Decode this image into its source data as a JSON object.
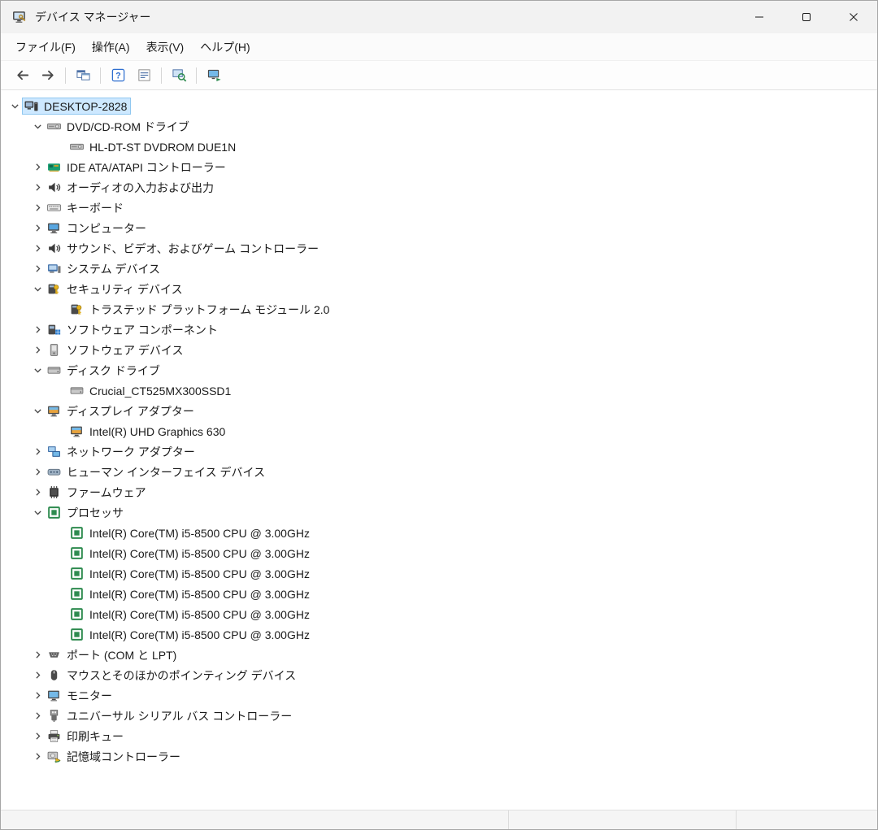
{
  "window": {
    "title": "デバイス マネージャー"
  },
  "menu": {
    "items": [
      {
        "label": "ファイル(F)"
      },
      {
        "label": "操作(A)"
      },
      {
        "label": "表示(V)"
      },
      {
        "label": "ヘルプ(H)"
      }
    ]
  },
  "toolbar": {
    "buttons": [
      "back",
      "forward",
      "show-console-tree",
      "help",
      "properties",
      "scan-hardware-changes",
      "update-driver"
    ]
  },
  "tree": {
    "items": [
      {
        "label": "DESKTOP-2828",
        "level": 0,
        "state": "expanded",
        "icon": "computer",
        "selected": true
      },
      {
        "label": "DVD/CD-ROM ドライブ",
        "level": 1,
        "state": "expanded",
        "icon": "dvd",
        "selected": false
      },
      {
        "label": "HL-DT-ST DVDROM DUE1N",
        "level": 2,
        "state": "leaf",
        "icon": "dvd",
        "selected": false
      },
      {
        "label": "IDE ATA/ATAPI コントローラー",
        "level": 1,
        "state": "collapsed",
        "icon": "ide",
        "selected": false
      },
      {
        "label": "オーディオの入力および出力",
        "level": 1,
        "state": "collapsed",
        "icon": "audio",
        "selected": false
      },
      {
        "label": "キーボード",
        "level": 1,
        "state": "collapsed",
        "icon": "keyboard",
        "selected": false
      },
      {
        "label": "コンピューター",
        "level": 1,
        "state": "collapsed",
        "icon": "computer2",
        "selected": false
      },
      {
        "label": "サウンド、ビデオ、およびゲーム コントローラー",
        "level": 1,
        "state": "collapsed",
        "icon": "sound",
        "selected": false
      },
      {
        "label": "システム デバイス",
        "level": 1,
        "state": "collapsed",
        "icon": "system",
        "selected": false
      },
      {
        "label": "セキュリティ デバイス",
        "level": 1,
        "state": "expanded",
        "icon": "security",
        "selected": false
      },
      {
        "label": "トラステッド プラットフォーム モジュール 2.0",
        "level": 2,
        "state": "leaf",
        "icon": "security",
        "selected": false
      },
      {
        "label": "ソフトウェア コンポーネント",
        "level": 1,
        "state": "collapsed",
        "icon": "software-component",
        "selected": false
      },
      {
        "label": "ソフトウェア デバイス",
        "level": 1,
        "state": "collapsed",
        "icon": "software-device",
        "selected": false
      },
      {
        "label": "ディスク ドライブ",
        "level": 1,
        "state": "expanded",
        "icon": "disk",
        "selected": false
      },
      {
        "label": "Crucial_CT525MX300SSD1",
        "level": 2,
        "state": "leaf",
        "icon": "disk",
        "selected": false
      },
      {
        "label": "ディスプレイ アダプター",
        "level": 1,
        "state": "expanded",
        "icon": "display",
        "selected": false
      },
      {
        "label": "Intel(R) UHD Graphics 630",
        "level": 2,
        "state": "leaf",
        "icon": "display",
        "selected": false
      },
      {
        "label": "ネットワーク アダプター",
        "level": 1,
        "state": "collapsed",
        "icon": "network",
        "selected": false
      },
      {
        "label": "ヒューマン インターフェイス デバイス",
        "level": 1,
        "state": "collapsed",
        "icon": "hid",
        "selected": false
      },
      {
        "label": "ファームウェア",
        "level": 1,
        "state": "collapsed",
        "icon": "firmware",
        "selected": false
      },
      {
        "label": "プロセッサ",
        "level": 1,
        "state": "expanded",
        "icon": "processor",
        "selected": false
      },
      {
        "label": "Intel(R) Core(TM) i5-8500 CPU @ 3.00GHz",
        "level": 2,
        "state": "leaf",
        "icon": "processor",
        "selected": false
      },
      {
        "label": "Intel(R) Core(TM) i5-8500 CPU @ 3.00GHz",
        "level": 2,
        "state": "leaf",
        "icon": "processor",
        "selected": false
      },
      {
        "label": "Intel(R) Core(TM) i5-8500 CPU @ 3.00GHz",
        "level": 2,
        "state": "leaf",
        "icon": "processor",
        "selected": false
      },
      {
        "label": "Intel(R) Core(TM) i5-8500 CPU @ 3.00GHz",
        "level": 2,
        "state": "leaf",
        "icon": "processor",
        "selected": false
      },
      {
        "label": "Intel(R) Core(TM) i5-8500 CPU @ 3.00GHz",
        "level": 2,
        "state": "leaf",
        "icon": "processor",
        "selected": false
      },
      {
        "label": "Intel(R) Core(TM) i5-8500 CPU @ 3.00GHz",
        "level": 2,
        "state": "leaf",
        "icon": "processor",
        "selected": false
      },
      {
        "label": "ポート (COM と LPT)",
        "level": 1,
        "state": "collapsed",
        "icon": "port",
        "selected": false
      },
      {
        "label": "マウスとそのほかのポインティング デバイス",
        "level": 1,
        "state": "collapsed",
        "icon": "mouse",
        "selected": false
      },
      {
        "label": "モニター",
        "level": 1,
        "state": "collapsed",
        "icon": "monitor",
        "selected": false
      },
      {
        "label": "ユニバーサル シリアル バス コントローラー",
        "level": 1,
        "state": "collapsed",
        "icon": "usb",
        "selected": false
      },
      {
        "label": "印刷キュー",
        "level": 1,
        "state": "collapsed",
        "icon": "printer",
        "selected": false
      },
      {
        "label": "記憶域コントローラー",
        "level": 1,
        "state": "collapsed",
        "icon": "storage",
        "selected": false
      }
    ]
  }
}
